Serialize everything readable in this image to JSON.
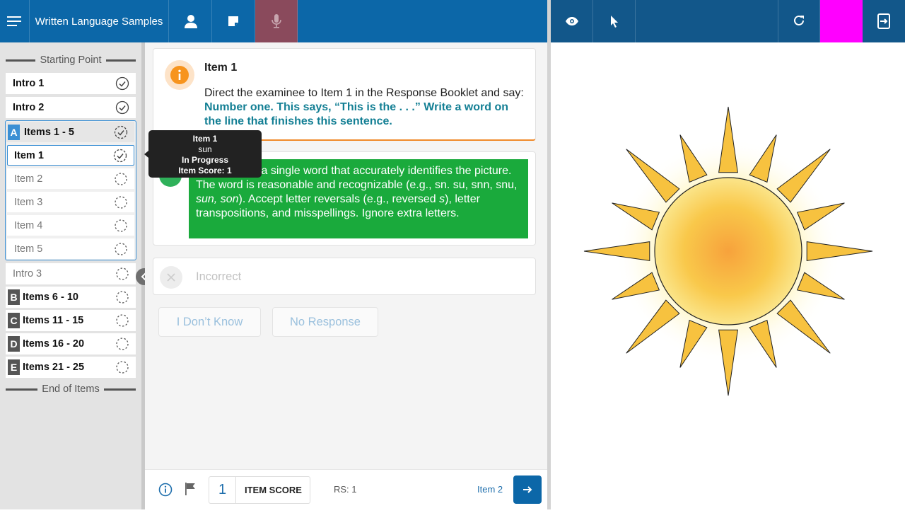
{
  "header": {
    "title": "Written Language Samples",
    "accent_color": "#ff00ff"
  },
  "sidebar": {
    "starting_point": "Starting Point",
    "end_of_items": "End of Items",
    "intro1": "Intro 1",
    "intro2": "Intro 2",
    "groupA": {
      "letter": "A",
      "label": "Items 1 - 5"
    },
    "items": [
      "Item 1",
      "Item 2",
      "Item 3",
      "Item 4",
      "Item 5"
    ],
    "intro3": "Intro 3",
    "groups": [
      {
        "letter": "B",
        "label": "Items 6 - 10"
      },
      {
        "letter": "C",
        "label": "Items 11 - 15"
      },
      {
        "letter": "D",
        "label": "Items 16 - 20"
      },
      {
        "letter": "E",
        "label": "Items 21 - 25"
      }
    ]
  },
  "tooltip": {
    "title": "Item 1",
    "word": "sun",
    "status": "In Progress",
    "score": "Item Score: 1"
  },
  "instruction": {
    "title": "Item 1",
    "text": "Direct the examinee to Item 1 in the Response Booklet and say: ",
    "say": "Number one. This says, “This is the . . .” Write a word on the line that finishes this sentence."
  },
  "correct": {
    "text1": "Response is a single word that accurately identifies the picture. The word is reasonable and recognizable (e.g., sn. su, snn, snu, ",
    "italic1": "sun, son",
    "text2": "). Accept letter reversals (e.g., reversed ",
    "italic2": "s",
    "text3": "), letter transpositions, and misspellings. Ignore extra letters."
  },
  "incorrect": {
    "label": "Incorrect"
  },
  "buttons": {
    "dont_know": "I Don’t Know",
    "no_response": "No Response"
  },
  "footer": {
    "score_value": "1",
    "score_label": "ITEM SCORE",
    "rs": "RS: 1",
    "next_item": "Item 2"
  }
}
